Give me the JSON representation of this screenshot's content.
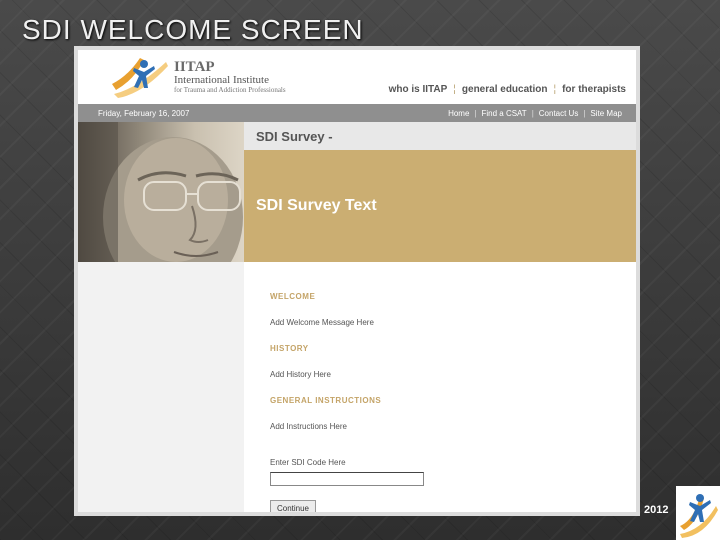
{
  "slide": {
    "title": "SDI WELCOME SCREEN",
    "year": "2012"
  },
  "site": {
    "logo_abbr": "IITAP",
    "logo_line1": "International Institute",
    "logo_line2": "for Trauma and Addiction Professionals",
    "top_nav": [
      "who is IITAP",
      "general education",
      "for therapists"
    ],
    "date": "Friday, February 16, 2007",
    "sub_nav": [
      "Home",
      "Find a CSAT",
      "Contact Us",
      "Site Map"
    ]
  },
  "survey": {
    "header": "SDI Survey -",
    "band_text": "SDI Survey Text"
  },
  "content": {
    "welcome_heading": "WELCOME",
    "welcome_body": "Add Welcome Message Here",
    "history_heading": "HISTORY",
    "history_body": "Add History Here",
    "instructions_heading": "GENERAL INSTRUCTIONS",
    "instructions_body": "Add Instructions Here",
    "code_label": "Enter SDI Code Here",
    "code_value": "",
    "continue_label": "Continue"
  },
  "colors": {
    "accent_gold": "#cbae72",
    "heading_gold": "#c4a468",
    "logo_blue": "#2f6fb5",
    "logo_orange": "#e8a030"
  }
}
